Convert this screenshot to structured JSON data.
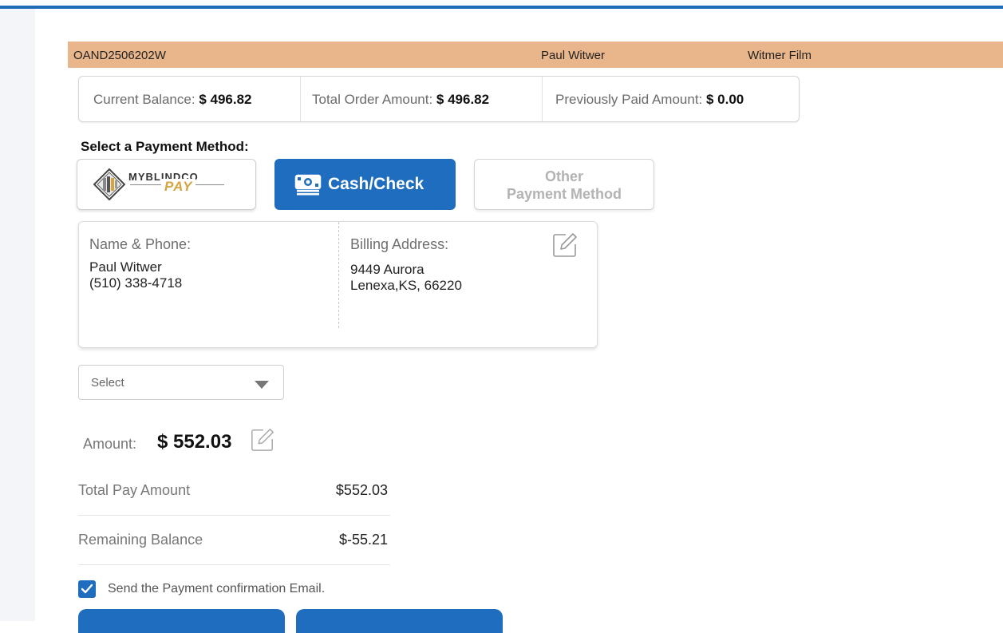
{
  "order": {
    "id": "OAND2506202W",
    "customer": "Paul Witwer",
    "company": "Witmer Film"
  },
  "balance": {
    "current_label": "Current Balance:",
    "current_value": "$ 496.82",
    "total_label": "Total Order Amount:",
    "total_value": "$ 496.82",
    "previous_label": "Previously Paid Amount:",
    "previous_value": "$ 0.00"
  },
  "payment": {
    "section_title": "Select a Payment Method:",
    "methods": [
      {
        "logo_top": "MYBLINDCO",
        "logo_bottom": "PAY",
        "icon": "myblindco-logo-icon",
        "selected": false
      },
      {
        "label": "Cash/Check",
        "icon": "cash-icon",
        "selected": true
      },
      {
        "label_line1": "Other",
        "label_line2": "Payment Method",
        "selected": false
      }
    ]
  },
  "contact": {
    "name_label": "Name & Phone:",
    "name": "Paul Witwer",
    "phone": "(510) 338-4718",
    "address_label": "Billing Address:",
    "address_line1": "9449 Aurora",
    "address_line2": "Lenexa,KS, 66220"
  },
  "select": {
    "value": "Select"
  },
  "amount": {
    "label": "Amount:",
    "value": "$ 552.03"
  },
  "summary": [
    {
      "label": "Total Pay Amount",
      "value": "$552.03"
    },
    {
      "label": "Remaining Balance",
      "value": "$-55.21"
    }
  ],
  "confirmation": {
    "checked": true,
    "label": "Send the Payment confirmation Email."
  },
  "colors": {
    "accent": "#1f6dbf",
    "order_strip": "#e9b58a",
    "gold": "#d4a640"
  }
}
